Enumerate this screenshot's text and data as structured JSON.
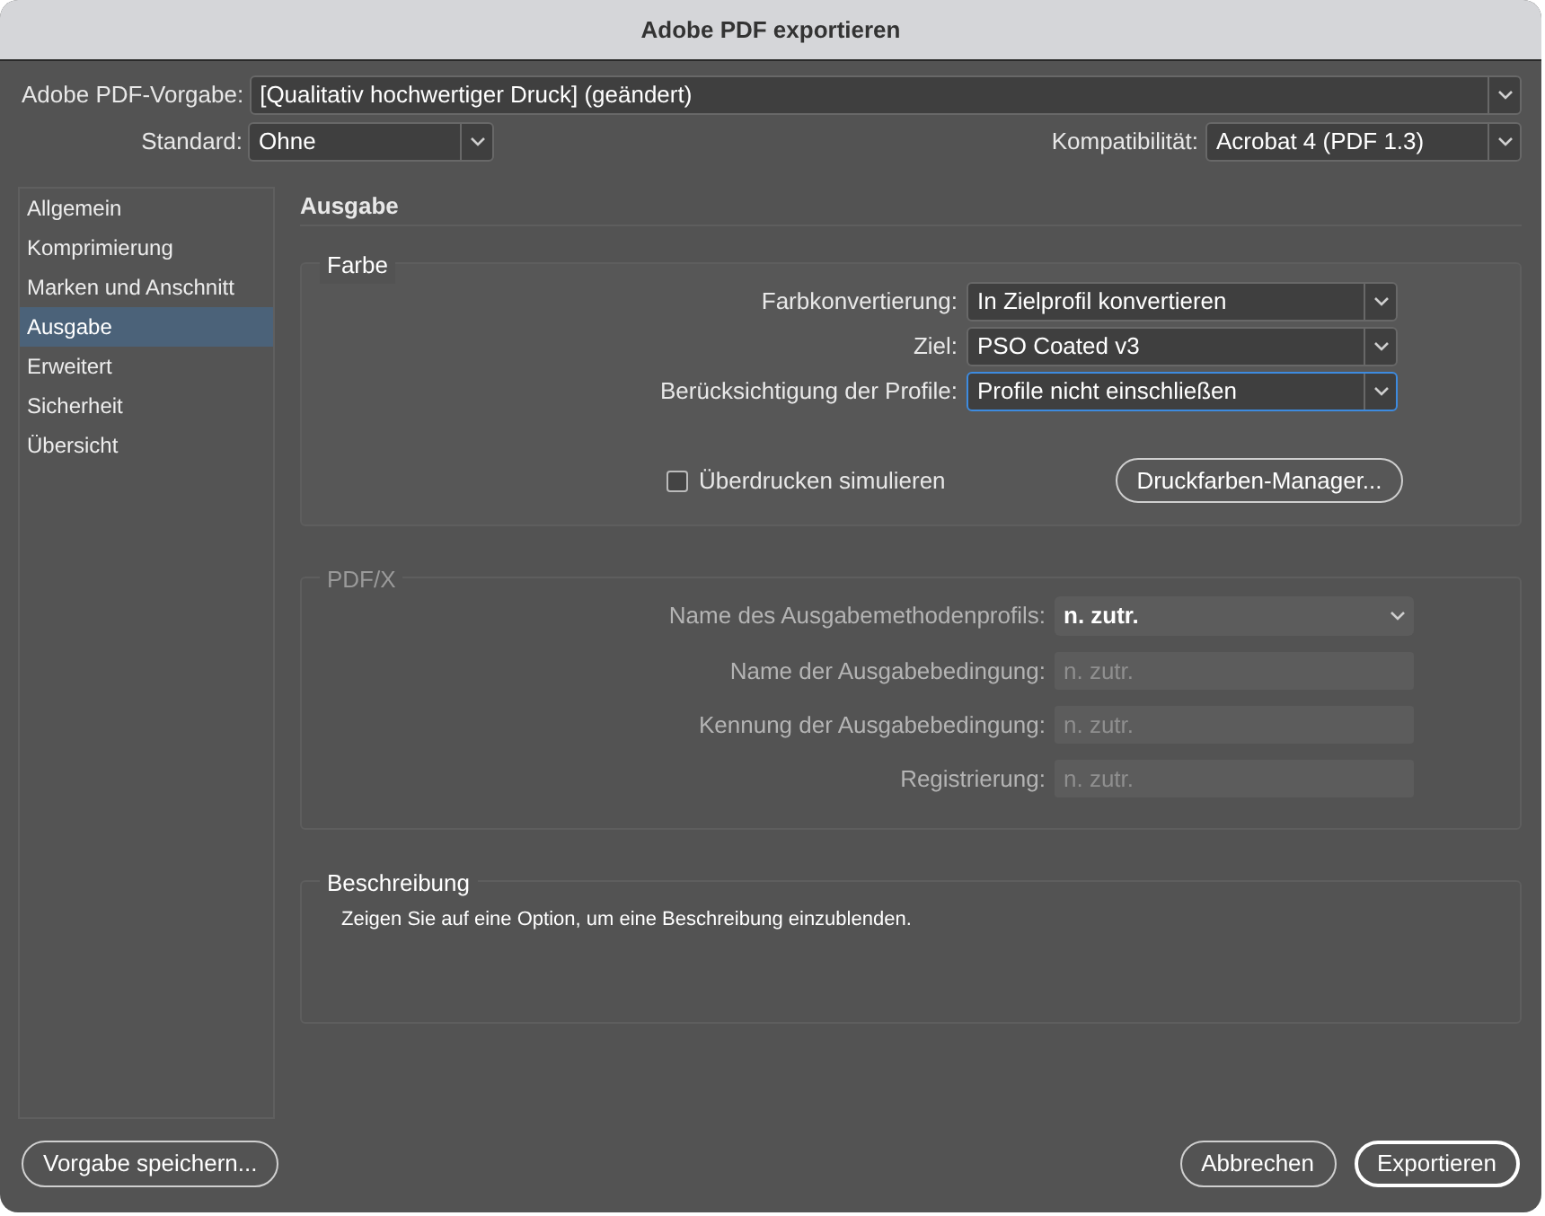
{
  "window": {
    "title": "Adobe PDF exportieren"
  },
  "preset": {
    "label": "Adobe PDF-Vorgabe:",
    "value": "[Qualitativ hochwertiger Druck] (geändert)"
  },
  "standard": {
    "label": "Standard:",
    "value": "Ohne"
  },
  "compatibility": {
    "label": "Kompatibilität:",
    "value": "Acrobat 4 (PDF 1.3)"
  },
  "sidebar": {
    "items": [
      {
        "label": "Allgemein",
        "selected": false
      },
      {
        "label": "Komprimierung",
        "selected": false
      },
      {
        "label": "Marken und Anschnitt",
        "selected": false
      },
      {
        "label": "Ausgabe",
        "selected": true
      },
      {
        "label": "Erweitert",
        "selected": false
      },
      {
        "label": "Sicherheit",
        "selected": false
      },
      {
        "label": "Übersicht",
        "selected": false
      }
    ]
  },
  "section_title": "Ausgabe",
  "color_group": {
    "title": "Farbe",
    "disabled": false,
    "fields": [
      {
        "kind": "select",
        "label": "Farbkonvertierung:",
        "value": "In Zielprofil konvertieren",
        "focused": false
      },
      {
        "kind": "select",
        "label": "Ziel:",
        "value": "PSO Coated v3",
        "focused": false
      },
      {
        "kind": "select",
        "label": "Berücksichtigung der Profile:",
        "value": "Profile nicht einschließen",
        "focused": true
      }
    ],
    "checkbox": {
      "label": "Überdrucken simulieren",
      "checked": false
    },
    "button": "Druckfarben-Manager..."
  },
  "pdfx_group": {
    "title": "PDF/X",
    "disabled": true,
    "fields": [
      {
        "kind": "select",
        "label": "Name des Ausgabemethodenprofils:",
        "value": "n. zutr."
      },
      {
        "kind": "text",
        "label": "Name der Ausgabebedingung:",
        "placeholder": "n. zutr."
      },
      {
        "kind": "text",
        "label": "Kennung der Ausgabebedingung:",
        "placeholder": "n. zutr."
      },
      {
        "kind": "text",
        "label": "Registrierung:",
        "placeholder": "n. zutr."
      }
    ]
  },
  "description": {
    "title": "Beschreibung",
    "text": "Zeigen Sie auf eine Option, um eine Beschreibung einzublenden."
  },
  "buttons": [
    {
      "label": "Vorgabe speichern...",
      "kind": "secondary"
    },
    {
      "label": "Abbrechen",
      "kind": "secondary"
    },
    {
      "label": "Exportieren",
      "kind": "default"
    }
  ]
}
